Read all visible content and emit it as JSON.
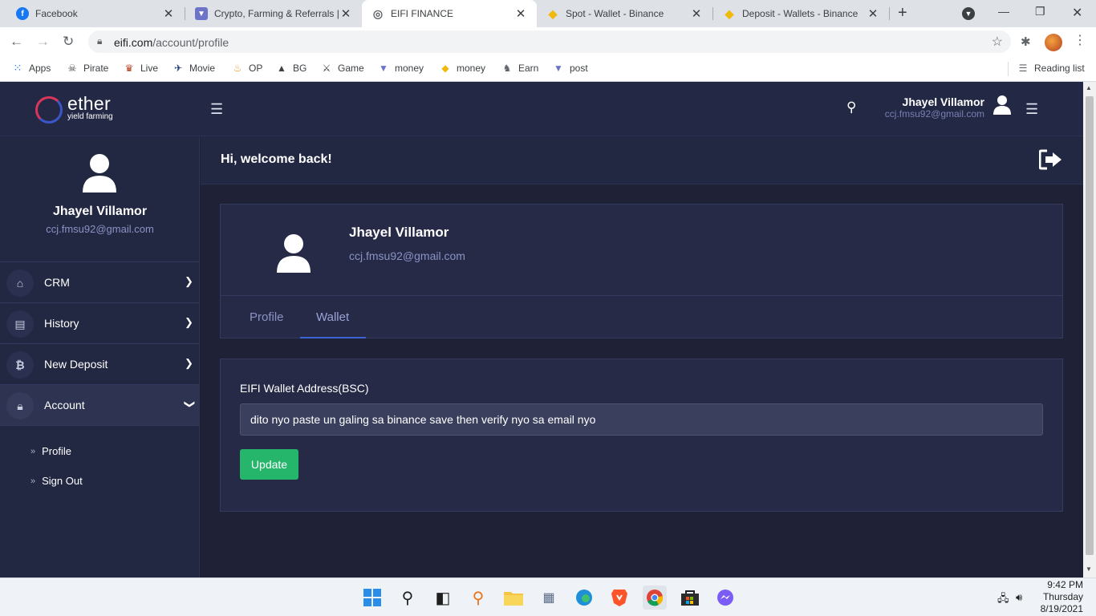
{
  "browser": {
    "tabs": [
      {
        "title": "Facebook",
        "icon": "facebook-icon",
        "color": "#1877f2",
        "glyph": "f"
      },
      {
        "title": "Crypto, Farming & Referrals |",
        "icon": "crypto-shield-icon",
        "color": "#6b74c9",
        "glyph": "▼"
      },
      {
        "title": "EIFI FINANCE",
        "icon": "globe-icon",
        "color": "#5f6368",
        "glyph": "◎"
      },
      {
        "title": "Spot - Wallet - Binance",
        "icon": "binance-icon",
        "color": "#f0b90b",
        "glyph": "◆"
      },
      {
        "title": "Deposit - Wallets - Binance",
        "icon": "binance-icon",
        "color": "#f0b90b",
        "glyph": "◆"
      }
    ],
    "url_host": "eifi.com",
    "url_path": "/account/profile",
    "bookmarks": [
      {
        "label": "Apps",
        "icon": "apps-grid-icon"
      },
      {
        "label": "Pirate",
        "icon": "pirate-icon"
      },
      {
        "label": "Live",
        "icon": "live-icon"
      },
      {
        "label": "Movie",
        "icon": "movie-icon"
      },
      {
        "label": "OP",
        "icon": "op-icon"
      },
      {
        "label": "BG",
        "icon": "bg-icon"
      },
      {
        "label": "Game",
        "icon": "game-icon"
      },
      {
        "label": "money",
        "icon": "money-shield-icon"
      },
      {
        "label": "money",
        "icon": "money-diamond-icon"
      },
      {
        "label": "Earn",
        "icon": "earn-icon"
      },
      {
        "label": "post",
        "icon": "post-shield-icon"
      }
    ],
    "reading_list": "Reading list"
  },
  "app": {
    "logo": {
      "brand": "ether",
      "tagline": "yield farming"
    },
    "user": {
      "name": "Jhayel Villamor",
      "email": "ccj.fmsu92@gmail.com"
    },
    "sidebar": {
      "menu": [
        {
          "label": "CRM",
          "icon": "home-icon"
        },
        {
          "label": "History",
          "icon": "history-icon"
        },
        {
          "label": "New Deposit",
          "icon": "bitcoin-icon"
        },
        {
          "label": "Account",
          "icon": "lock-icon"
        }
      ],
      "submenu": [
        {
          "label": "Profile"
        },
        {
          "label": "Sign Out"
        }
      ]
    },
    "header": {
      "welcome": "Hi, welcome back!"
    },
    "profile_tabs": [
      "Profile",
      "Wallet"
    ],
    "active_tab": "Wallet",
    "wallet": {
      "label": "EIFI Wallet Address(BSC)",
      "value": "dito nyo paste un galing sa binance save then verify nyo sa email nyo",
      "button": "Update"
    }
  },
  "taskbar": {
    "time": "9:42 PM",
    "day": "Thursday",
    "date": "8/19/2021"
  },
  "colors": {
    "app_bg": "#1f2236",
    "panel_bg": "#262a47",
    "accent_tab": "#3e63d6",
    "update_button": "#25b56b"
  }
}
